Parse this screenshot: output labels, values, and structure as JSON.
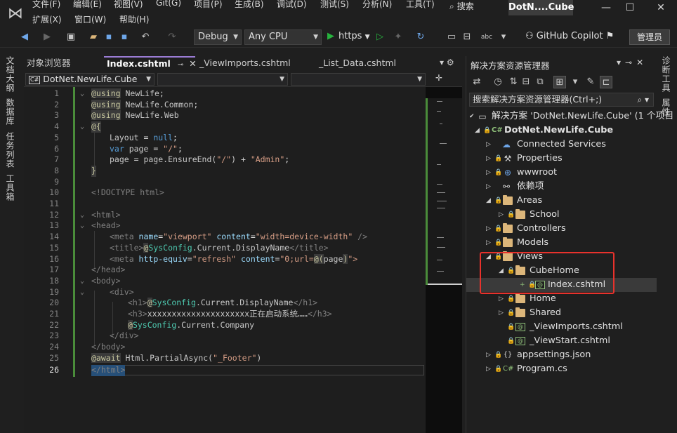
{
  "menu": {
    "row1": [
      "文件(F)",
      "编辑(E)",
      "视图(V)",
      "Git(G)",
      "项目(P)",
      "生成(B)",
      "调试(D)",
      "测试(S)",
      "分析(N)",
      "工具(T)"
    ],
    "row2": [
      "扩展(X)",
      "窗口(W)",
      "帮助(H)"
    ],
    "search_label": "搜索",
    "solution_name": "DotN....Cube"
  },
  "toolbar": {
    "config": "Debug",
    "platform": "Any CPU",
    "run_target": "https",
    "copilot": "GitHub Copilot",
    "admin": "管理员"
  },
  "left_tabs": [
    "文档大纲",
    "数据库",
    "任务列表",
    "工具箱"
  ],
  "right_tabs": [
    "诊断工具",
    "属性"
  ],
  "editor_tabs": [
    {
      "label": "对象浏览器"
    },
    {
      "label": "Index.cshtml"
    },
    {
      "label": "_ViewImports.cshtml"
    },
    {
      "label": "_List_Data.cshtml"
    }
  ],
  "navbar": {
    "project": "DotNet.NewLife.Cube",
    "project_badge": "C#"
  },
  "code_lines": [
    {
      "n": "1"
    },
    {
      "n": "2"
    },
    {
      "n": "3"
    },
    {
      "n": "4"
    },
    {
      "n": "5"
    },
    {
      "n": "6"
    },
    {
      "n": "7"
    },
    {
      "n": "8"
    },
    {
      "n": "9"
    },
    {
      "n": "10"
    },
    {
      "n": "11"
    },
    {
      "n": "12"
    },
    {
      "n": "13"
    },
    {
      "n": "14"
    },
    {
      "n": "15"
    },
    {
      "n": "16"
    },
    {
      "n": "17"
    },
    {
      "n": "18"
    },
    {
      "n": "19"
    },
    {
      "n": "20"
    },
    {
      "n": "21"
    },
    {
      "n": "22"
    },
    {
      "n": "23"
    },
    {
      "n": "24"
    },
    {
      "n": "25"
    },
    {
      "n": "26"
    }
  ],
  "code": {
    "l1_kw": "@using",
    "l1_ns": " NewLife;",
    "l2_kw": "@using",
    "l2_ns": " NewLife.Common;",
    "l3_kw": "@using",
    "l3_ns": " NewLife.Web",
    "l4": "@{",
    "l5_a": "Layout",
    "l5_b": " = ",
    "l5_c": "null",
    "l5_d": ";",
    "l6_a": "var",
    "l6_b": " page = ",
    "l6_c": "\"/\"",
    "l6_d": ";",
    "l7_a": "page = page.EnsureEnd(",
    "l7_b": "\"/\"",
    "l7_c": ") + ",
    "l7_d": "\"Admin\"",
    "l7_e": ";",
    "l8": "}",
    "l10": "<!DOCTYPE html>",
    "l12": "<html>",
    "l13": "<head>",
    "l14_a": "<meta ",
    "l14_b": "name",
    "l14_c": "=",
    "l14_d": "\"viewport\"",
    "l14_e": " content",
    "l14_f": "=",
    "l14_g": "\"width=device-width\"",
    "l14_h": " />",
    "l15_a": "<title>",
    "l15_b": "@",
    "l15_c": "SysConfig",
    "l15_d": ".Current.DisplayName",
    "l15_e": "</title>",
    "l16_a": "<meta ",
    "l16_b": "http-equiv",
    "l16_c": "=",
    "l16_d": "\"refresh\"",
    "l16_e": " content",
    "l16_f": "=",
    "l16_g": "\"0;url=",
    "l16_h": "@(",
    "l16_i": "page",
    "l16_j": ")",
    "l16_k": "\">",
    "l17": "</head>",
    "l18": "<body>",
    "l19": "<div>",
    "l20_a": "<h1>",
    "l20_b": "@",
    "l20_c": "SysConfig",
    "l20_d": ".Current.DisplayName",
    "l20_e": "</h1>",
    "l21_a": "<h3>",
    "l21_b": "xxxxxxxxxxxxxxxxxxxxx正在启动系统……",
    "l21_c": "</h3>",
    "l22_a": "@",
    "l22_b": "SysConfig",
    "l22_c": ".Current.Company",
    "l23": "</div>",
    "l24": "</body>",
    "l25_a": "@await",
    "l25_b": " Html.PartialAsync(",
    "l25_c": "\"_Footer\"",
    "l25_d": ")",
    "l26": "</html>"
  },
  "solution_explorer": {
    "title": "解决方案资源管理器",
    "search_placeholder": "搜索解决方案资源管理器(Ctrl+;)",
    "nodes": [
      {
        "label": "解决方案 'DotNet.NewLife.Cube' (1 个项目"
      },
      {
        "label": "DotNet.NewLife.Cube"
      },
      {
        "label": "Connected Services"
      },
      {
        "label": "Properties"
      },
      {
        "label": "wwwroot"
      },
      {
        "label": "依赖项"
      },
      {
        "label": "Areas"
      },
      {
        "label": "School"
      },
      {
        "label": "Controllers"
      },
      {
        "label": "Models"
      },
      {
        "label": "Views"
      },
      {
        "label": "CubeHome"
      },
      {
        "label": "Index.cshtml"
      },
      {
        "label": "Home"
      },
      {
        "label": "Shared"
      },
      {
        "label": "_ViewImports.cshtml"
      },
      {
        "label": "_ViewStart.cshtml"
      },
      {
        "label": "appsettings.json"
      },
      {
        "label": "Program.cs"
      }
    ]
  },
  "colors": {
    "accent": "#9a7cd4",
    "highlight_box": "#e8322c",
    "change_bar": "#4a8c3a",
    "run_green": "#27b33e"
  }
}
